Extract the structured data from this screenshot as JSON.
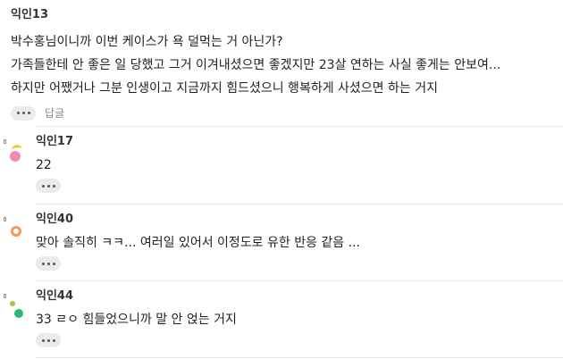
{
  "top_comment": {
    "author": "익인13",
    "lines": [
      "박수홍님이니까 이번 케이스가 욕 덜먹는 거 아닌가?",
      "가족들한테 안 좋은 일 당했고 그거 이겨내셨으면 좋겠지만 23살 연하는 사실 좋게는 안보여...",
      "하지만 어쨌거나 그분 인생이고 지금까지 힘드셨으니 행복하게 사셨으면 하는 거지"
    ],
    "more_icon": "ellipsis-icon",
    "reply_label": "답글"
  },
  "replies": [
    {
      "author": "익인17",
      "text": "22",
      "avatar_colors": [
        "#f5c518",
        "#f08ab0"
      ]
    },
    {
      "author": "익인40",
      "text": "맞아 솔직히 ㅋㅋ... 여러일 있어서 이정도로 유한 반응 같음 ...",
      "avatar_colors": [
        "#f39a5c",
        "#f39a5c"
      ]
    },
    {
      "author": "익인44",
      "text": "33 ㄹㅇ 힘들었으니까 말 안 얹는 거지",
      "avatar_colors": [
        "#a8c43a",
        "#2eb872"
      ]
    }
  ]
}
